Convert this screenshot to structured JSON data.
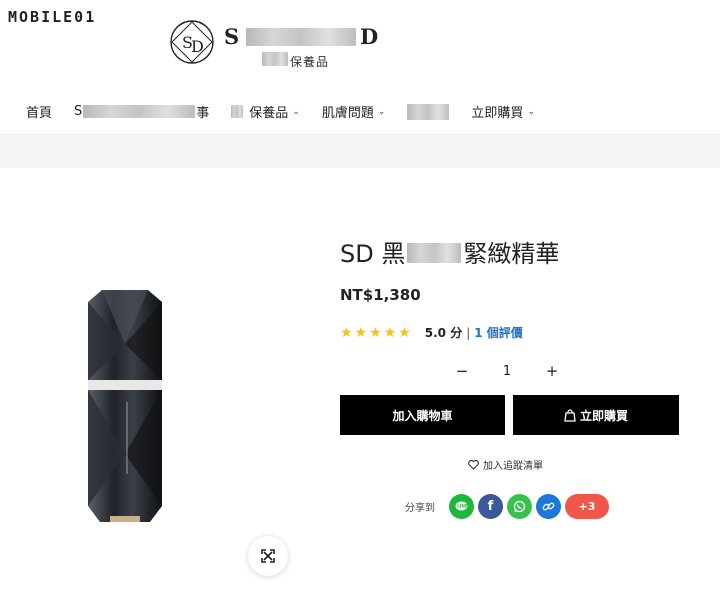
{
  "watermark": {
    "text": "MOBILE01"
  },
  "header": {
    "brand_name": "S",
    "brand_name_end": "D",
    "brand_sub": "保養品"
  },
  "nav": {
    "items": [
      {
        "label": "首頁",
        "has_chevron": false
      },
      {
        "label": "S",
        "label_end": "事",
        "has_chevron": false
      },
      {
        "label": "保養品",
        "has_chevron": true
      },
      {
        "label": "肌膚問題",
        "has_chevron": true
      },
      {
        "label": "",
        "has_chevron": false
      },
      {
        "label": "立即購買",
        "has_chevron": true
      }
    ]
  },
  "product": {
    "title_start": "SD 黑",
    "title_end": "緊緻精華",
    "price": "NT$1,380",
    "stars": "★★★★★",
    "rating_value": 5,
    "score": "5.0 分",
    "separator": "|",
    "review_link": "1 個評價",
    "quantity": "1",
    "qty_minus": "−",
    "qty_plus": "+",
    "add_to_cart": "加入購物車",
    "buy_now": "立即購買",
    "wishlist": "加入追蹤清單"
  },
  "share": {
    "label": "分享到",
    "more": "+3",
    "colors": {
      "line": "#1db83b",
      "facebook": "#3b5998",
      "whatsapp": "#39c150",
      "link": "#1d77d9",
      "more": "#f0574b"
    }
  },
  "icons": [
    "logo-emblem-icon",
    "chevron-down-icon",
    "expand-icon",
    "shopping-bag-icon",
    "heart-icon",
    "line-icon",
    "facebook-icon",
    "whatsapp-icon",
    "link-icon"
  ]
}
